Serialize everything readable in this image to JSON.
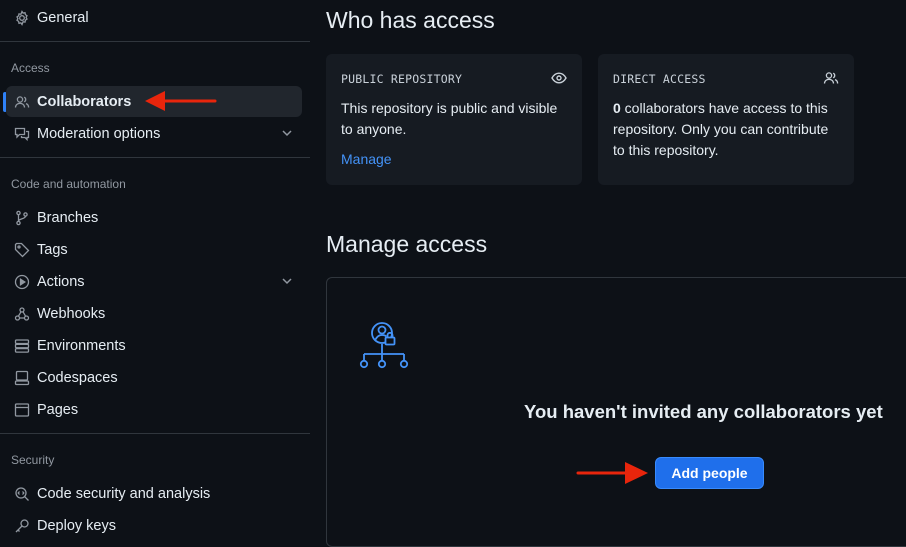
{
  "sidebar": {
    "general": "General",
    "sections": {
      "access": "Access",
      "code_automation": "Code and automation",
      "security": "Security"
    },
    "items": {
      "collaborators": "Collaborators",
      "moderation": "Moderation options",
      "branches": "Branches",
      "tags": "Tags",
      "actions": "Actions",
      "webhooks": "Webhooks",
      "environments": "Environments",
      "codespaces": "Codespaces",
      "pages": "Pages",
      "code_security": "Code security and analysis",
      "deploy_keys": "Deploy keys"
    }
  },
  "main": {
    "who_has_access": "Who has access",
    "public_card": {
      "kicker": "PUBLIC REPOSITORY",
      "description": "This repository is public and visible to anyone.",
      "link": "Manage"
    },
    "direct_card": {
      "kicker": "DIRECT ACCESS",
      "count": "0",
      "description_rest": " collaborators have access to this repository. Only you can contribute to this repository."
    },
    "manage_access": "Manage access",
    "empty_title": "You haven't invited any collaborators yet",
    "add_button": "Add people"
  },
  "colors": {
    "background": "#0d1117",
    "accent": "#2f81f7",
    "button": "#1f6feb",
    "annotation_arrow": "#e8250c"
  }
}
